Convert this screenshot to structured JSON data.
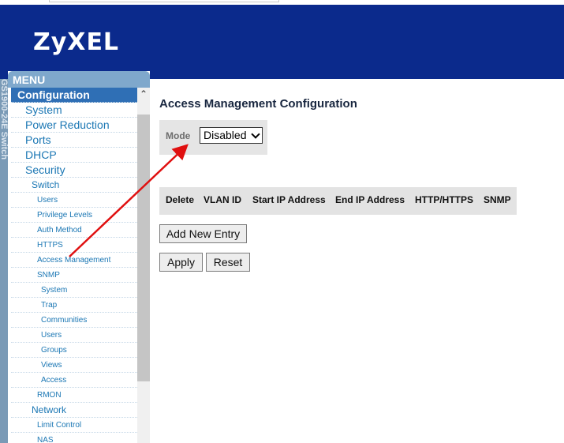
{
  "brand": {
    "logo": "ZyXEL"
  },
  "sidebar": {
    "edge_text": "GS1900-24E Switch",
    "menu_title": "MENU",
    "items": [
      {
        "label": "Configuration",
        "level": "sel"
      },
      {
        "label": "System",
        "level": "l0"
      },
      {
        "label": "Power Reduction",
        "level": "l0"
      },
      {
        "label": "Ports",
        "level": "l0"
      },
      {
        "label": "DHCP",
        "level": "l0"
      },
      {
        "label": "Security",
        "level": "l0"
      },
      {
        "label": "Switch",
        "level": "l1"
      },
      {
        "label": "Users",
        "level": "l2"
      },
      {
        "label": "Privilege Levels",
        "level": "l2"
      },
      {
        "label": "Auth Method",
        "level": "l2"
      },
      {
        "label": "HTTPS",
        "level": "l2"
      },
      {
        "label": "Access Management",
        "level": "l2"
      },
      {
        "label": "SNMP",
        "level": "l2"
      },
      {
        "label": "System",
        "level": "l3"
      },
      {
        "label": "Trap",
        "level": "l3"
      },
      {
        "label": "Communities",
        "level": "l3"
      },
      {
        "label": "Users",
        "level": "l3"
      },
      {
        "label": "Groups",
        "level": "l3"
      },
      {
        "label": "Views",
        "level": "l3"
      },
      {
        "label": "Access",
        "level": "l3"
      },
      {
        "label": "RMON",
        "level": "l2"
      },
      {
        "label": "Network",
        "level": "l1"
      },
      {
        "label": "Limit Control",
        "level": "l2"
      },
      {
        "label": "NAS",
        "level": "l2"
      }
    ]
  },
  "main": {
    "title": "Access Management Configuration",
    "mode": {
      "label": "Mode",
      "value": "Disabled"
    },
    "table": {
      "columns": [
        "Delete",
        "VLAN ID",
        "Start IP Address",
        "End IP Address",
        "HTTP/HTTPS",
        "SNMP"
      ]
    },
    "buttons": {
      "add": "Add New Entry",
      "apply": "Apply",
      "reset": "Reset"
    }
  },
  "colors": {
    "header": "#0b2a8c",
    "menu_link": "#1b77b4",
    "selected": "#2f6fb5",
    "annotation_arrow": "#e01010"
  }
}
